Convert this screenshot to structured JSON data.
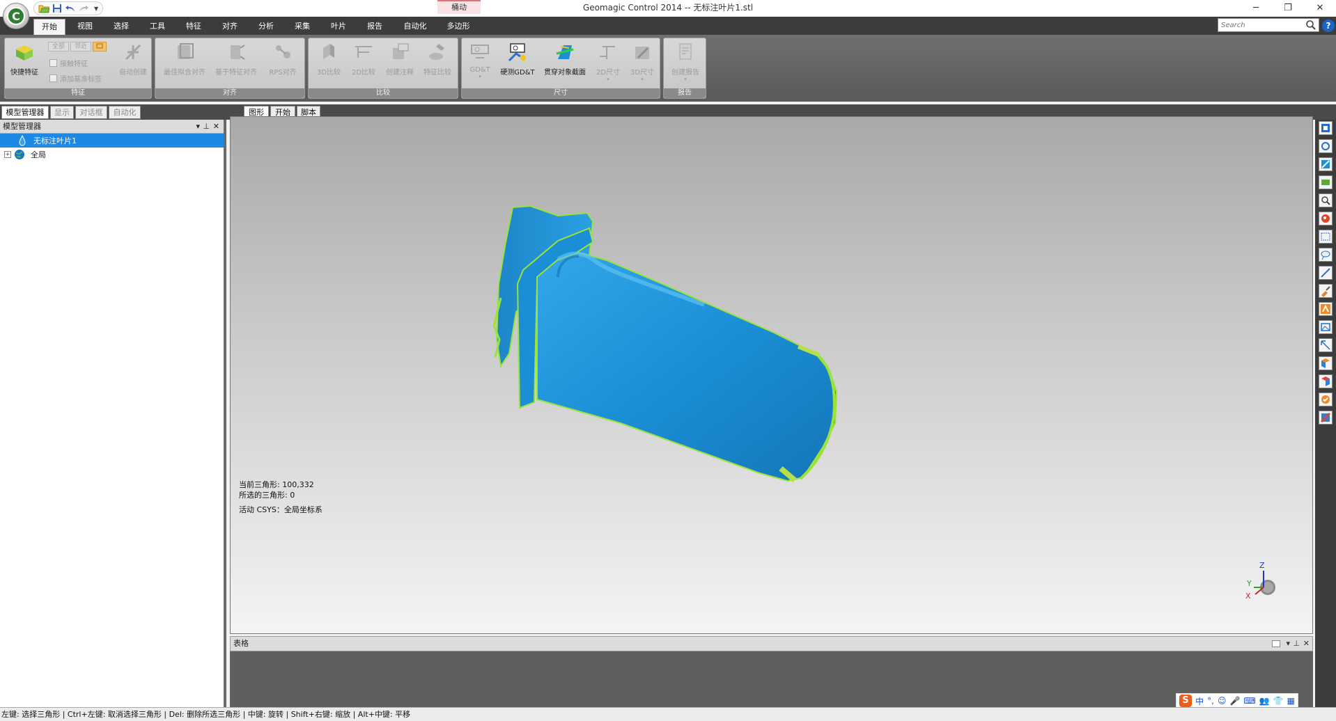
{
  "window": {
    "title": "Geomagic Control 2014 -- 无标注叶片1.stl",
    "context_tab": "桶动",
    "orb_letter": "C"
  },
  "ribbon": {
    "tabs": [
      "开始",
      "视图",
      "选择",
      "工具",
      "特征",
      "对齐",
      "分析",
      "采集",
      "叶片",
      "报告",
      "自动化",
      "多边形"
    ],
    "active_tab": "开始",
    "search_placeholder": "Search",
    "groups": {
      "features": {
        "title": "特征",
        "quick": "快捷特征",
        "all": "全部",
        "near": "邻近",
        "contact": "接触特征",
        "add_label": "添加基准标签",
        "auto_create": "自动创建"
      },
      "align": {
        "title": "对齐",
        "best_fit": "最佳拟合对齐",
        "feature_based": "基于特征对齐",
        "rps": "RPS对齐"
      },
      "compare": {
        "title": "比较",
        "compare3d": "3D比较",
        "compare2d": "2D比较",
        "annotate": "创建注释",
        "feature_compare": "特征比较"
      },
      "dimension": {
        "title": "尺寸",
        "gdt": "GD&T",
        "probe_gdt": "硬测GD&T",
        "section": "贯穿对象截面",
        "dim2d": "2D尺寸",
        "dim3d": "3D尺寸"
      },
      "report": {
        "title": "报告",
        "create": "创建报告"
      }
    }
  },
  "panel_tabs": [
    "模型管理器",
    "显示",
    "对话框",
    "自动化"
  ],
  "model_manager": {
    "title": "模型管理器",
    "items": [
      {
        "label": "无标注叶片1",
        "selected": true
      },
      {
        "label": "全局",
        "selected": false
      }
    ]
  },
  "doc_tabs": [
    "图形",
    "开始",
    "脚本"
  ],
  "viewport": {
    "current_triangles": "当前三角形: 100,332",
    "selected_triangles": "所选的三角形: 0",
    "active_csys": "活动 CSYS：全局坐标系",
    "axis_z": "Z",
    "axis_y": "Y",
    "axis_x": "X"
  },
  "table_panel": {
    "title": "表格"
  },
  "status_bar": {
    "text": "左键: 选择三角形 | Ctrl+左键: 取消选择三角形 | Del: 删除所选三角形 | 中键: 旋转 | Shift+右键: 缩放 | Alt+中键: 平移"
  },
  "ime": {
    "logo": "S",
    "lang": "中"
  },
  "colors": {
    "model_blue": "#1a8fd6",
    "model_green": "#9be23a",
    "selected_row": "#1e88e5",
    "dark_chrome": "#3c3c3c"
  }
}
